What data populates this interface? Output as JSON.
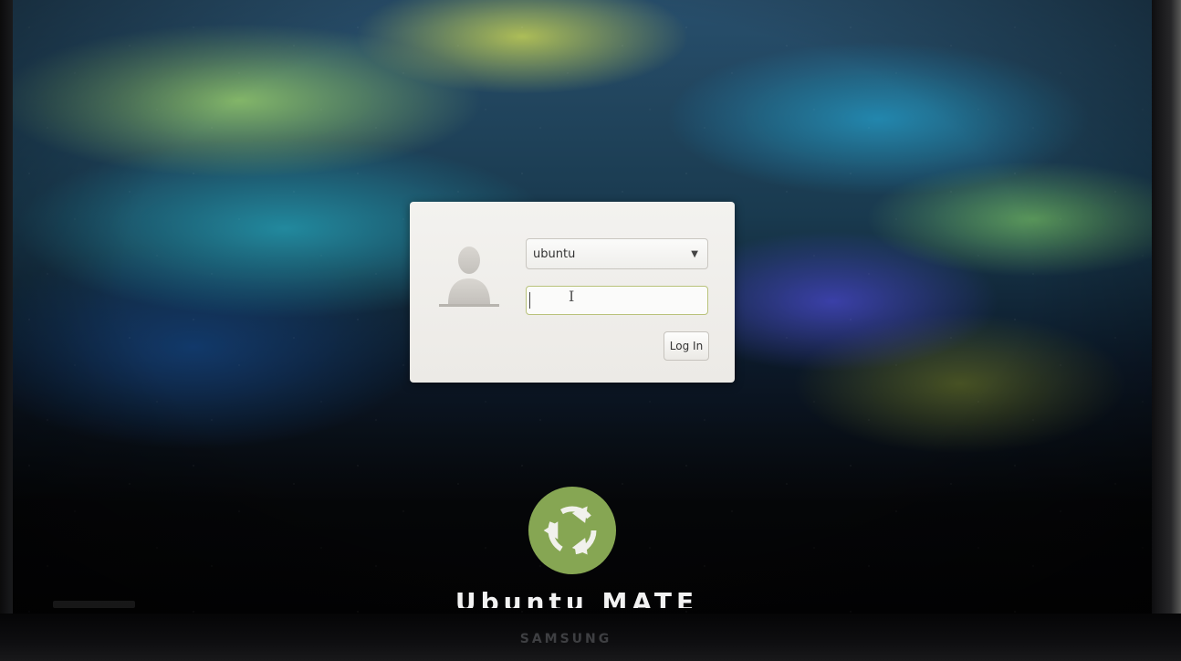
{
  "login": {
    "selected_user": "ubuntu",
    "password_value": "",
    "login_button_label": "Log In"
  },
  "branding": {
    "distro_name": "Ubuntu MATE",
    "accent_color": "#87a556"
  },
  "monitor": {
    "brand": "SAMSUNG"
  },
  "icons": {
    "avatar": "user-silhouette-icon",
    "dropdown": "chevron-down-icon",
    "cursor": "text-cursor-icon",
    "logo": "ubuntu-mate-logo"
  }
}
